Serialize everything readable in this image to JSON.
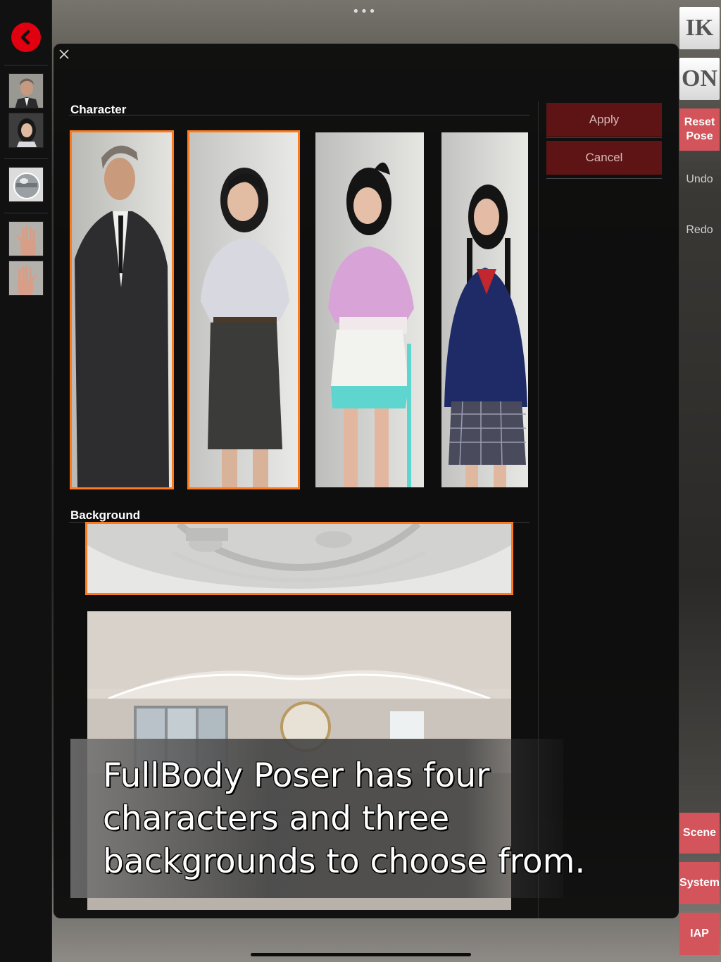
{
  "top": {
    "more_glyph": "•••"
  },
  "left_toolbar": {
    "back_icon": "chevron-left-icon",
    "thumbs": [
      "male-character",
      "female-character",
      "environment-sphere",
      "left-hand",
      "right-hand"
    ]
  },
  "right_toolbar": {
    "ik": "IK",
    "on": "ON",
    "reset_pose": "Reset Pose",
    "undo": "Undo",
    "redo": "Redo",
    "scene": "Scene",
    "system": "System",
    "iap": "IAP"
  },
  "modal": {
    "close_icon": "close-icon",
    "character_label": "Character",
    "background_label": "Background",
    "apply": "Apply",
    "cancel": "Cancel",
    "characters": [
      {
        "name": "man-in-suit",
        "selected": true
      },
      {
        "name": "office-woman",
        "selected": true
      },
      {
        "name": "pink-outfit-girl",
        "selected": false
      },
      {
        "name": "school-uniform-girl",
        "selected": false
      }
    ],
    "backgrounds": [
      {
        "name": "white-studio",
        "selected": true
      },
      {
        "name": "living-room",
        "selected": false
      }
    ]
  },
  "caption": {
    "line1": "FullBody Poser has four",
    "line2": "characters and three",
    "line3": "backgrounds to choose from."
  },
  "colors": {
    "accent_red": "#e1000f",
    "button_red": "#d3545a",
    "apply_bg": "#5e1414",
    "selection_orange": "#ff7a1a"
  }
}
